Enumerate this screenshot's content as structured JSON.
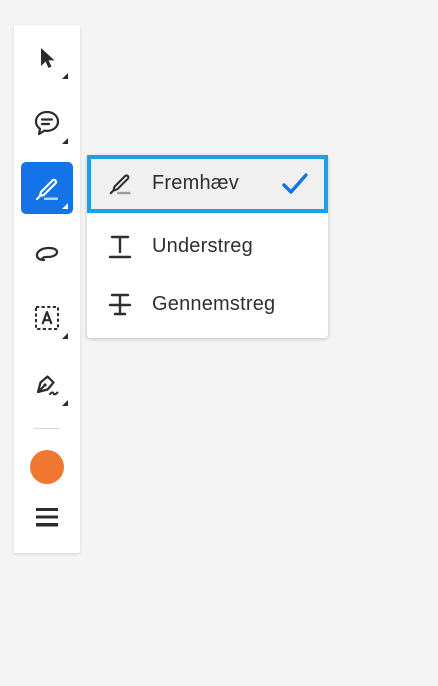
{
  "toolbar": {
    "tools": [
      {
        "name": "select",
        "icon": "arrow-cursor-icon"
      },
      {
        "name": "comment",
        "icon": "comment-icon"
      },
      {
        "name": "highlight",
        "icon": "highlighter-icon",
        "active": true
      },
      {
        "name": "freehand",
        "icon": "lasso-icon"
      },
      {
        "name": "text-box",
        "icon": "text-box-icon"
      },
      {
        "name": "sign",
        "icon": "pen-sign-icon"
      }
    ],
    "color": "#ef7730",
    "accent": "#1473e6"
  },
  "popup": {
    "items": [
      {
        "label": "Fremhæv",
        "icon": "highlighter-icon",
        "selected": true
      },
      {
        "label": "Understreg",
        "icon": "underline-icon",
        "selected": false
      },
      {
        "label": "Gennemstreg",
        "icon": "strikethrough-icon",
        "selected": false
      }
    ],
    "check_color": "#1473e6",
    "focus_ring_color": "#1ea0e6"
  }
}
